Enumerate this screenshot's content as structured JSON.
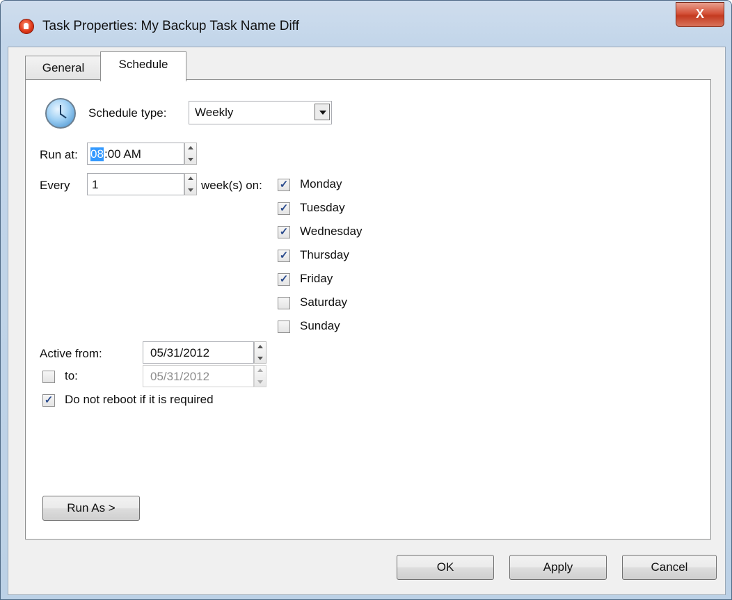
{
  "window": {
    "title": "Task Properties: My Backup Task Name Diff",
    "close_label": "X"
  },
  "tabs": [
    {
      "label": "General",
      "selected": false
    },
    {
      "label": "Schedule",
      "selected": true
    }
  ],
  "schedule": {
    "type_label": "Schedule type:",
    "type_value": "Weekly",
    "run_at_label": "Run at:",
    "run_at_hour": "08",
    "run_at_rest": ":00 AM",
    "every_label": "Every",
    "every_value": "1",
    "weeks_on_label": "week(s) on:",
    "days": [
      {
        "label": "Monday",
        "checked": true
      },
      {
        "label": "Tuesday",
        "checked": true
      },
      {
        "label": "Wednesday",
        "checked": true
      },
      {
        "label": "Thursday",
        "checked": true
      },
      {
        "label": "Friday",
        "checked": true
      },
      {
        "label": "Saturday",
        "checked": false
      },
      {
        "label": "Sunday",
        "checked": false
      }
    ],
    "active_from_label": "Active from:",
    "active_from_value": "05/31/2012",
    "to_label": "to:",
    "to_checked": false,
    "to_value": "05/31/2012",
    "no_reboot_label": "Do not reboot if it is required",
    "no_reboot_checked": true,
    "run_as_label": "Run As >"
  },
  "footer": {
    "ok_label": "OK",
    "apply_label": "Apply",
    "cancel_label": "Cancel"
  },
  "check_glyph": "✓"
}
